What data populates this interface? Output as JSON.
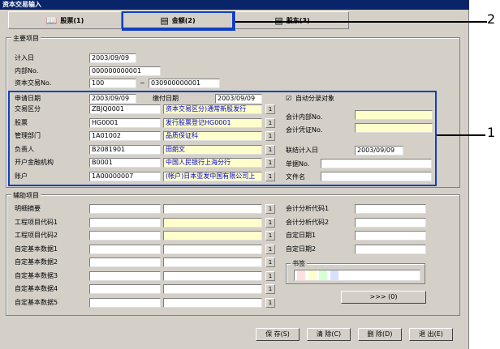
{
  "window_title": "资本交易输入",
  "tabs": [
    {
      "icon": "📖",
      "label": "股票(1)"
    },
    {
      "icon": "▤",
      "label": "金额(2)"
    },
    {
      "icon": "▤",
      "label": "股东(3)"
    }
  ],
  "main": {
    "title": "主要项目",
    "record_date_label": "计入日",
    "record_date": "2003/09/09",
    "internal_no_label": "内部No.",
    "internal_no": "000000000001",
    "capital_no_label": "资本交易No.",
    "capital_no_from": "100",
    "capital_no_sep": "~",
    "capital_no_to": "030900000001",
    "apply_date_label": "申请日期",
    "apply_date": "2003/09/09",
    "pay_date_label": "缴付日期",
    "pay_date": "2003/09/09",
    "auto_check_mark": "☑",
    "auto_label": "自动分录对象",
    "rows": [
      {
        "label": "交易区分",
        "code": "ZBJQ0001",
        "name": "资本交易区分)通常新股发行"
      },
      {
        "label": "股票",
        "code": "HG0001",
        "name": "发行股票登记HG0001"
      },
      {
        "label": "管理部门",
        "code": "1A01002",
        "name": "品质保证科"
      },
      {
        "label": "负责人",
        "code": "B2081901",
        "name": "田朗文"
      },
      {
        "label": "开户金融机构",
        "code": "B0001",
        "name": "中国人民银行上海分行"
      },
      {
        "label": "账户",
        "code": "1A00000007",
        "name": "(帐户)日本亚发中国有限公司上"
      }
    ],
    "lookup_btn": "1",
    "acct_internal_label": "会计内部No.",
    "acct_internal": "",
    "acct_voucher_label": "会计凭证No.",
    "acct_voucher": "",
    "link_date_label": "联结计入日",
    "link_date": "2003/09/09",
    "bill_no_label": "单据No.",
    "bill_no": "",
    "file_name_label": "文件名",
    "file_name": ""
  },
  "aux": {
    "title": "辅助项目",
    "rows": [
      {
        "label": "明细摘要"
      },
      {
        "label": "工程项目代码1"
      },
      {
        "label": "工程项目代码2"
      },
      {
        "label": "自定基本数据1"
      },
      {
        "label": "自定基本数据2"
      },
      {
        "label": "自定基本数据3"
      },
      {
        "label": "自定基本数据4"
      },
      {
        "label": "自定基本数据5"
      }
    ],
    "right": [
      {
        "label": "会计分析代码1"
      },
      {
        "label": "会计分析代码2"
      },
      {
        "label": "自定日期1"
      },
      {
        "label": "自定日期2"
      }
    ],
    "tag_title": "书签",
    "more_btn": ">>>   (0)"
  },
  "buttons": [
    {
      "label": "保 存(S)"
    },
    {
      "label": "清 除(C)"
    },
    {
      "label": "删 除(D)"
    },
    {
      "label": "退 出(E)"
    }
  ],
  "annotations": {
    "a1": "1",
    "a2": "2"
  },
  "colors": {
    "title_bg": "#0a246a",
    "highlight": "#1040c0",
    "face": "#d4d0c8",
    "yellow": "#ffffcc"
  }
}
